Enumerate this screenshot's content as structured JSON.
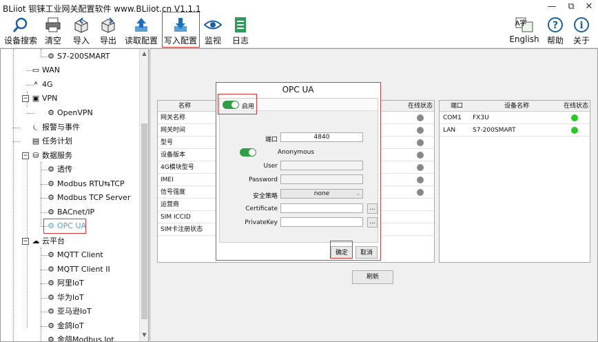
{
  "window": {
    "title": "BLiiot 钡铼工业网关配置软件 www.BLiiot.cn V1.1.1",
    "minimize": "—",
    "restore": "⧉",
    "close": "✕"
  },
  "toolbar": {
    "search": "设备搜索",
    "clear": "清空",
    "import": "导入",
    "export": "导出",
    "read_config": "读取配置",
    "write_config": "写入配置",
    "monitor": "监视",
    "log": "日志",
    "english": "English",
    "help": "帮助",
    "about": "关于",
    "english_icon_text": "A字"
  },
  "tree": {
    "s7": "S7-200SMART",
    "wan": "WAN",
    "g4": "4G",
    "vpn": "VPN",
    "openvpn": "OpenVPN",
    "alarm": "报警与事件",
    "task": "任务计划",
    "data_service": "数据服务",
    "passthrough": "透传",
    "modbus_rtu_tcp": "Modbus RTU⇆TCP",
    "modbus_tcp_server": "Modbus TCP Server",
    "bacnet": "BACnet/IP",
    "opcua": "OPC UA",
    "cloud": "云平台",
    "mqtt": "MQTT Client",
    "mqtt2": "MQTT Client II",
    "ali": "阿里IoT",
    "huawei": "华为IoT",
    "amazon": "亚马逊IoT",
    "jinger": "金鸽IoT",
    "last": "金鸽Modbus Iot"
  },
  "left_table": {
    "header_name": "名称",
    "rows": [
      "网关名称",
      "网关时间",
      "型号",
      "设备版本",
      "4G模块型号",
      "IMEI",
      "信号强度",
      "运营商",
      "SIM ICCID",
      "SIM卡注册状态"
    ]
  },
  "mid_table": {
    "header_status": "在线状态"
  },
  "right_table": {
    "header_port": "端口",
    "header_device": "设备名称",
    "header_status": "在线状态",
    "rows": [
      {
        "port": "COM1",
        "device": "FX3U"
      },
      {
        "port": "LAN",
        "device": "S7-200SMART"
      }
    ]
  },
  "refresh": "刷新",
  "dialog": {
    "title": "OPC UA",
    "enable": "启用",
    "port_label": "端口",
    "port_value": "4840",
    "anonymous": "Anonymous",
    "user_label": "User",
    "password_label": "Password",
    "policy_label": "安全策略",
    "policy_value": "none",
    "cert_label": "Certificate",
    "key_label": "PrivateKey",
    "browse": "...",
    "ok": "确定",
    "cancel": "取消"
  },
  "colors": {
    "online": "#22cc22",
    "offline": "#888888",
    "highlight": "#dd3333",
    "accent": "#2f9e44"
  }
}
